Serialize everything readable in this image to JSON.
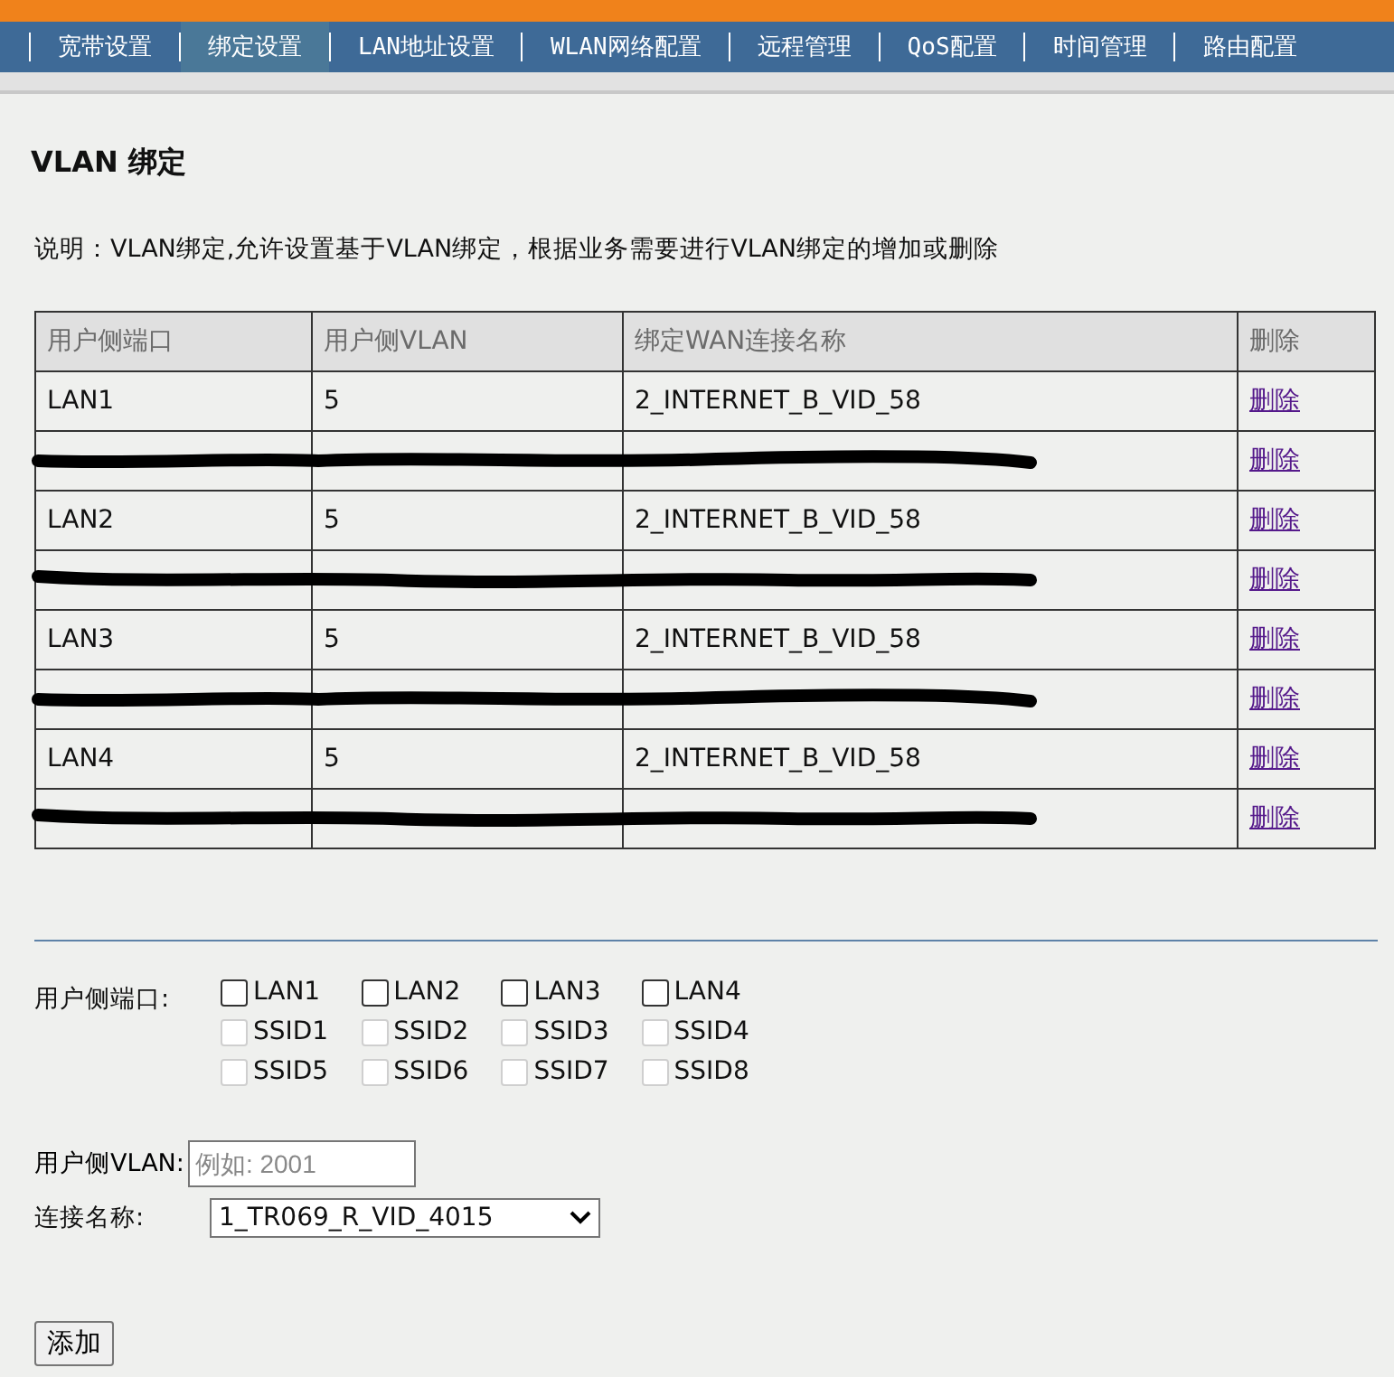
{
  "nav_tabs": [
    {
      "label": "宽带设置",
      "selected": false
    },
    {
      "label": "绑定设置",
      "selected": true
    },
    {
      "label": "LAN地址设置",
      "selected": false
    },
    {
      "label": "WLAN网络配置",
      "selected": false
    },
    {
      "label": "远程管理",
      "selected": false
    },
    {
      "label": "QoS配置",
      "selected": false
    },
    {
      "label": "时间管理",
      "selected": false
    },
    {
      "label": "路由配置",
      "selected": false
    }
  ],
  "title": "VLAN 绑定",
  "description": "说明：VLAN绑定,允许设置基于VLAN绑定，根据业务需要进行VLAN绑定的增加或删除",
  "table": {
    "columns": [
      "用户侧端口",
      "用户侧VLAN",
      "绑定WAN连接名称",
      "删除"
    ],
    "rows": [
      {
        "kind": "plain",
        "cells": [
          "LAN1",
          "5",
          "2_INTERNET_B_VID_58"
        ],
        "action": "删除"
      },
      {
        "kind": "redacted",
        "cells": [],
        "action": "删除"
      },
      {
        "kind": "plain",
        "cells": [
          "LAN2",
          "5",
          "2_INTERNET_B_VID_58"
        ],
        "action": "删除"
      },
      {
        "kind": "redacted",
        "cells": [],
        "action": "删除"
      },
      {
        "kind": "plain",
        "cells": [
          "LAN3",
          "5",
          "2_INTERNET_B_VID_58"
        ],
        "action": "删除"
      },
      {
        "kind": "redacted",
        "cells": [],
        "action": "删除"
      },
      {
        "kind": "plain",
        "cells": [
          "LAN4",
          "5",
          "2_INTERNET_B_VID_58"
        ],
        "action": "删除"
      },
      {
        "kind": "redacted",
        "cells": [],
        "action": "删除"
      }
    ]
  },
  "form": {
    "port_label": "用户侧端口:",
    "port_rows": [
      [
        {
          "label": "LAN1",
          "checked": false,
          "disabled": false
        },
        {
          "label": "LAN2",
          "checked": false,
          "disabled": false
        },
        {
          "label": "LAN3",
          "checked": false,
          "disabled": false
        },
        {
          "label": "LAN4",
          "checked": false,
          "disabled": false
        }
      ],
      [
        {
          "label": "SSID1",
          "checked": false,
          "disabled": true
        },
        {
          "label": "SSID2",
          "checked": false,
          "disabled": true
        },
        {
          "label": "SSID3",
          "checked": false,
          "disabled": true
        },
        {
          "label": "SSID4",
          "checked": false,
          "disabled": true
        }
      ],
      [
        {
          "label": "SSID5",
          "checked": false,
          "disabled": true
        },
        {
          "label": "SSID6",
          "checked": false,
          "disabled": true
        },
        {
          "label": "SSID7",
          "checked": false,
          "disabled": true
        },
        {
          "label": "SSID8",
          "checked": false,
          "disabled": true
        }
      ]
    ],
    "vlan_label": "用户侧VLAN:",
    "vlan_placeholder": "例如: 2001",
    "conn_label": "连接名称:",
    "conn_value": "1_TR069_R_VID_4015",
    "add_button": "添加"
  }
}
